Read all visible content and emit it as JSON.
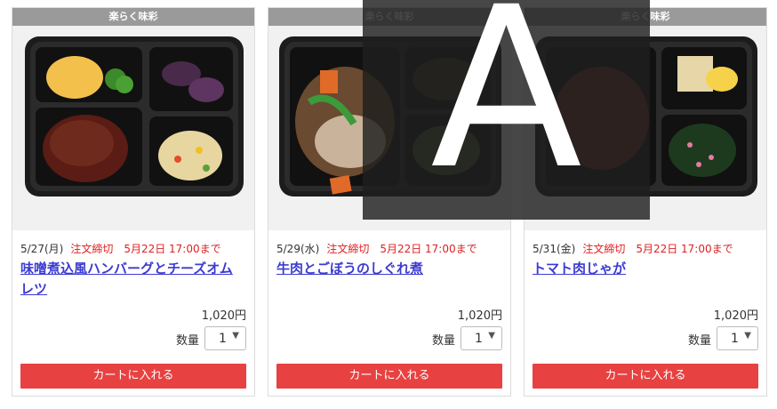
{
  "products": [
    {
      "badge": "楽らく味彩",
      "date": "5/27(月)",
      "deadline": "注文締切　5月22日 17:00まで",
      "title": "味噌煮込風ハンバーグとチーズオムレツ",
      "price": "1,020円",
      "qty_label": "数量",
      "qty_value": "1",
      "cart_label": "カートに入れる",
      "image_icon": "bento-hamburg-omelet"
    },
    {
      "badge": "楽らく味彩",
      "date": "5/29(水)",
      "deadline": "注文締切　5月22日 17:00まで",
      "title": "牛肉とごぼうのしぐれ煮",
      "price": "1,020円",
      "qty_label": "数量",
      "qty_value": "1",
      "cart_label": "カートに入れる",
      "image_icon": "bento-beef-burdock"
    },
    {
      "badge": "楽らく味彩",
      "date": "5/31(金)",
      "deadline": "注文締切　5月22日 17:00まで",
      "title": "トマト肉じゃが",
      "price": "1,020円",
      "qty_label": "数量",
      "qty_value": "1",
      "cart_label": "カートに入れる",
      "image_icon": "bento-tomato-nikujaga"
    }
  ],
  "overlay": {
    "letter": "A"
  },
  "colors": {
    "deadline": "#e02020",
    "link": "#3b3bd1",
    "cart": "#e84141",
    "badge": "#9a9a9a"
  }
}
